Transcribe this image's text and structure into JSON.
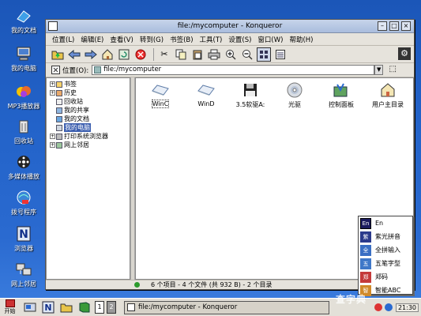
{
  "desktop": {
    "icons": [
      {
        "label": "我的文档",
        "icon": "documents-icon"
      },
      {
        "label": "我的电脑",
        "icon": "computer-icon"
      },
      {
        "label": "MP3播放器",
        "icon": "music-player-icon"
      },
      {
        "label": "回收站",
        "icon": "trash-icon"
      },
      {
        "label": "多媒体播放",
        "icon": "film-reel-icon"
      },
      {
        "label": "拨号程序",
        "icon": "dialer-icon"
      },
      {
        "label": "浏览器",
        "icon": "browser-n-icon"
      },
      {
        "label": "网上邻居",
        "icon": "network-icon"
      }
    ]
  },
  "window": {
    "title": "file:/mycomputer - Konqueror",
    "menu": [
      "位置(L)",
      "编辑(E)",
      "查看(V)",
      "转到(G)",
      "书签(B)",
      "工具(T)",
      "设置(S)",
      "窗口(W)",
      "帮助(H)"
    ],
    "toolbar": [
      "up-folder-icon",
      "back-icon",
      "forward-icon",
      "home-icon",
      "reload-icon",
      "stop-icon",
      "cut-icon",
      "copy-icon",
      "paste-icon",
      "print-icon",
      "zoom-in-icon",
      "zoom-out-icon",
      "icon-view-icon",
      "detail-view-icon"
    ],
    "location": {
      "label": "位置(O):",
      "value": "file:/mycomputer"
    },
    "tree": [
      {
        "label": "书签",
        "expander": "+"
      },
      {
        "label": "历史",
        "expander": "+"
      },
      {
        "label": "回收站",
        "expander": ""
      },
      {
        "label": "我的共享",
        "expander": ""
      },
      {
        "label": "我的文档",
        "expander": ""
      },
      {
        "label": "我的电脑",
        "expander": "",
        "selected": true
      },
      {
        "label": "打印系统浏览器",
        "expander": "+"
      },
      {
        "label": "网上邻居",
        "expander": "+"
      }
    ],
    "files": [
      {
        "label": "WinC",
        "icon": "drive-icon",
        "selected": true
      },
      {
        "label": "WinD",
        "icon": "drive-icon"
      },
      {
        "label": "3.5软驱A:",
        "icon": "floppy-icon"
      },
      {
        "label": "光驱",
        "icon": "cdrom-icon"
      },
      {
        "label": "控制面板",
        "icon": "control-panel-icon"
      },
      {
        "label": "用户主目录",
        "icon": "home-folder-icon"
      }
    ],
    "status": "6 个项目 - 4 个文件 (共 932 B) - 2 个目录"
  },
  "ime": {
    "items": [
      {
        "label": "En",
        "badge": "En"
      },
      {
        "label": "紫光拼音",
        "badge": "紫"
      },
      {
        "label": "全拼输入",
        "badge": "全"
      },
      {
        "label": "五笔字型",
        "badge": "五"
      },
      {
        "label": "郑码",
        "badge": "郑"
      },
      {
        "label": "智能ABC",
        "badge": "智"
      }
    ]
  },
  "taskbar": {
    "start_label": "开始",
    "desktops": [
      "1",
      "2"
    ],
    "task_label": "file:/mycomputer - Konqueror",
    "clock": "21:30"
  },
  "watermark": "查字典"
}
